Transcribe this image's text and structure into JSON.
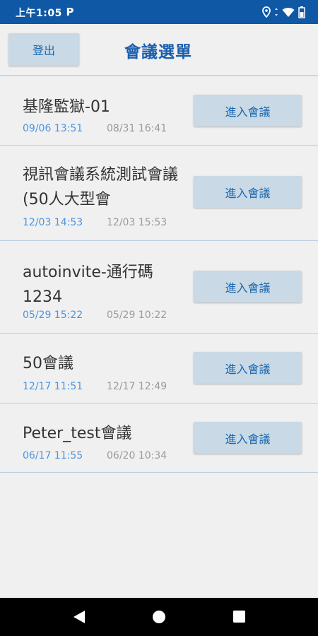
{
  "status_bar": {
    "time": "上午1:05",
    "notification_icon": "parking-p-icon",
    "icons": [
      "location-icon",
      "wifi-icon",
      "battery-icon"
    ]
  },
  "header": {
    "logout_label": "登出",
    "title": "會議選單"
  },
  "meetings": [
    {
      "title": "基隆監獄-01",
      "start": "09/06 13:51",
      "end": "08/31 16:41",
      "button": "進入會議"
    },
    {
      "title": "視訊會議系統測試會議(50人大型會",
      "start": "12/03 14:53",
      "end": "12/03 15:53",
      "button": "進入會議"
    },
    {
      "title": "autoinvite-通行碼1234",
      "start": "05/29 15:22",
      "end": "05/29 10:22",
      "button": "進入會議"
    },
    {
      "title": "50會議",
      "start": "12/17 11:51",
      "end": "12/17 12:49",
      "button": "進入會議"
    },
    {
      "title": "Peter_test會議",
      "start": "06/17 11:55",
      "end": "06/20 10:34",
      "button": "進入會議"
    }
  ],
  "nav_bar": {
    "icons": [
      "back-icon",
      "home-icon",
      "recents-icon"
    ]
  },
  "colors": {
    "status_bar": "#0f58a6",
    "title": "#1a5fad",
    "button_bg": "#c9d9e5",
    "start_time": "#4a95e0",
    "end_time": "#9a9a9a"
  }
}
